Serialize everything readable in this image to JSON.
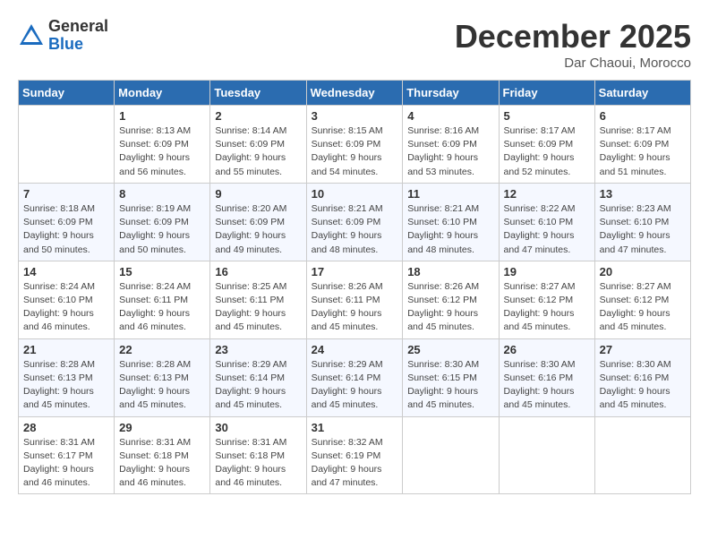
{
  "logo": {
    "general": "General",
    "blue": "Blue"
  },
  "header": {
    "month": "December 2025",
    "location": "Dar Chaoui, Morocco"
  },
  "weekdays": [
    "Sunday",
    "Monday",
    "Tuesday",
    "Wednesday",
    "Thursday",
    "Friday",
    "Saturday"
  ],
  "weeks": [
    [
      {
        "day": "",
        "info": ""
      },
      {
        "day": "1",
        "info": "Sunrise: 8:13 AM\nSunset: 6:09 PM\nDaylight: 9 hours\nand 56 minutes."
      },
      {
        "day": "2",
        "info": "Sunrise: 8:14 AM\nSunset: 6:09 PM\nDaylight: 9 hours\nand 55 minutes."
      },
      {
        "day": "3",
        "info": "Sunrise: 8:15 AM\nSunset: 6:09 PM\nDaylight: 9 hours\nand 54 minutes."
      },
      {
        "day": "4",
        "info": "Sunrise: 8:16 AM\nSunset: 6:09 PM\nDaylight: 9 hours\nand 53 minutes."
      },
      {
        "day": "5",
        "info": "Sunrise: 8:17 AM\nSunset: 6:09 PM\nDaylight: 9 hours\nand 52 minutes."
      },
      {
        "day": "6",
        "info": "Sunrise: 8:17 AM\nSunset: 6:09 PM\nDaylight: 9 hours\nand 51 minutes."
      }
    ],
    [
      {
        "day": "7",
        "info": "Sunrise: 8:18 AM\nSunset: 6:09 PM\nDaylight: 9 hours\nand 50 minutes."
      },
      {
        "day": "8",
        "info": "Sunrise: 8:19 AM\nSunset: 6:09 PM\nDaylight: 9 hours\nand 50 minutes."
      },
      {
        "day": "9",
        "info": "Sunrise: 8:20 AM\nSunset: 6:09 PM\nDaylight: 9 hours\nand 49 minutes."
      },
      {
        "day": "10",
        "info": "Sunrise: 8:21 AM\nSunset: 6:09 PM\nDaylight: 9 hours\nand 48 minutes."
      },
      {
        "day": "11",
        "info": "Sunrise: 8:21 AM\nSunset: 6:10 PM\nDaylight: 9 hours\nand 48 minutes."
      },
      {
        "day": "12",
        "info": "Sunrise: 8:22 AM\nSunset: 6:10 PM\nDaylight: 9 hours\nand 47 minutes."
      },
      {
        "day": "13",
        "info": "Sunrise: 8:23 AM\nSunset: 6:10 PM\nDaylight: 9 hours\nand 47 minutes."
      }
    ],
    [
      {
        "day": "14",
        "info": "Sunrise: 8:24 AM\nSunset: 6:10 PM\nDaylight: 9 hours\nand 46 minutes."
      },
      {
        "day": "15",
        "info": "Sunrise: 8:24 AM\nSunset: 6:11 PM\nDaylight: 9 hours\nand 46 minutes."
      },
      {
        "day": "16",
        "info": "Sunrise: 8:25 AM\nSunset: 6:11 PM\nDaylight: 9 hours\nand 45 minutes."
      },
      {
        "day": "17",
        "info": "Sunrise: 8:26 AM\nSunset: 6:11 PM\nDaylight: 9 hours\nand 45 minutes."
      },
      {
        "day": "18",
        "info": "Sunrise: 8:26 AM\nSunset: 6:12 PM\nDaylight: 9 hours\nand 45 minutes."
      },
      {
        "day": "19",
        "info": "Sunrise: 8:27 AM\nSunset: 6:12 PM\nDaylight: 9 hours\nand 45 minutes."
      },
      {
        "day": "20",
        "info": "Sunrise: 8:27 AM\nSunset: 6:12 PM\nDaylight: 9 hours\nand 45 minutes."
      }
    ],
    [
      {
        "day": "21",
        "info": "Sunrise: 8:28 AM\nSunset: 6:13 PM\nDaylight: 9 hours\nand 45 minutes."
      },
      {
        "day": "22",
        "info": "Sunrise: 8:28 AM\nSunset: 6:13 PM\nDaylight: 9 hours\nand 45 minutes."
      },
      {
        "day": "23",
        "info": "Sunrise: 8:29 AM\nSunset: 6:14 PM\nDaylight: 9 hours\nand 45 minutes."
      },
      {
        "day": "24",
        "info": "Sunrise: 8:29 AM\nSunset: 6:14 PM\nDaylight: 9 hours\nand 45 minutes."
      },
      {
        "day": "25",
        "info": "Sunrise: 8:30 AM\nSunset: 6:15 PM\nDaylight: 9 hours\nand 45 minutes."
      },
      {
        "day": "26",
        "info": "Sunrise: 8:30 AM\nSunset: 6:16 PM\nDaylight: 9 hours\nand 45 minutes."
      },
      {
        "day": "27",
        "info": "Sunrise: 8:30 AM\nSunset: 6:16 PM\nDaylight: 9 hours\nand 45 minutes."
      }
    ],
    [
      {
        "day": "28",
        "info": "Sunrise: 8:31 AM\nSunset: 6:17 PM\nDaylight: 9 hours\nand 46 minutes."
      },
      {
        "day": "29",
        "info": "Sunrise: 8:31 AM\nSunset: 6:18 PM\nDaylight: 9 hours\nand 46 minutes."
      },
      {
        "day": "30",
        "info": "Sunrise: 8:31 AM\nSunset: 6:18 PM\nDaylight: 9 hours\nand 46 minutes."
      },
      {
        "day": "31",
        "info": "Sunrise: 8:32 AM\nSunset: 6:19 PM\nDaylight: 9 hours\nand 47 minutes."
      },
      {
        "day": "",
        "info": ""
      },
      {
        "day": "",
        "info": ""
      },
      {
        "day": "",
        "info": ""
      }
    ]
  ]
}
